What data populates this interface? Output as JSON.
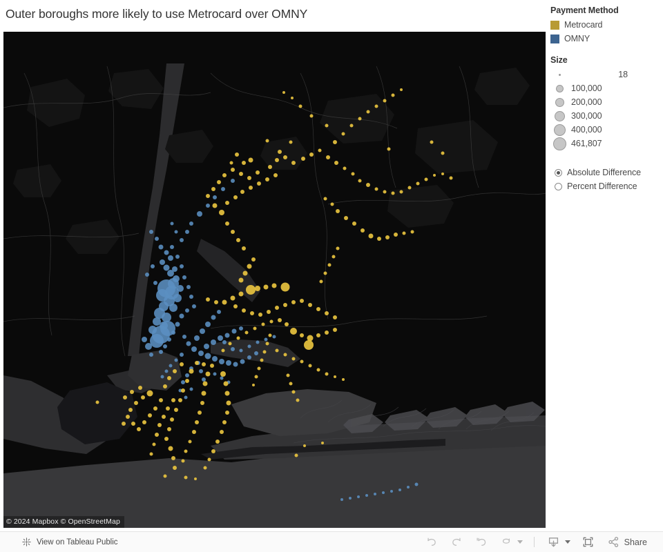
{
  "title": "Outer boroughs more likely to use Metrocard over OMNY",
  "map": {
    "attribution": "© 2024 Mapbox  © OpenStreetMap",
    "basemap_land": "#0a0a0a",
    "basemap_water": "#38383a",
    "basemap_parks": "#141414"
  },
  "legend": {
    "payment_method": {
      "title": "Payment Method",
      "items": [
        {
          "label": "Metrocard",
          "color": "#b89b35"
        },
        {
          "label": "OMNY",
          "color": "#3d6490"
        }
      ]
    },
    "size": {
      "title": "Size",
      "items": [
        {
          "value": "18",
          "diameter": 3
        },
        {
          "value": "100,000",
          "diameter": 11
        },
        {
          "value": "200,000",
          "diameter": 13
        },
        {
          "value": "300,000",
          "diameter": 15
        },
        {
          "value": "400,000",
          "diameter": 17
        },
        {
          "value": "461,807",
          "diameter": 19
        }
      ]
    }
  },
  "controls": {
    "options": [
      {
        "label": "Absolute Difference",
        "selected": true
      },
      {
        "label": "Percent Difference",
        "selected": false
      }
    ]
  },
  "toolbar": {
    "view_label": "View on Tableau Public",
    "tableau_logo_icon": "tableau-logo-icon",
    "buttons": [
      {
        "name": "undo-button",
        "icon": "undo-icon"
      },
      {
        "name": "redo-button",
        "icon": "redo-icon"
      },
      {
        "name": "revert-button",
        "icon": "revert-icon"
      },
      {
        "name": "refresh-button",
        "icon": "refresh-icon",
        "caret": true
      },
      {
        "name": "download-button",
        "icon": "download-icon",
        "caret": true
      },
      {
        "name": "fullscreen-button",
        "icon": "fullscreen-icon"
      }
    ],
    "share_label": "Share",
    "share_icon": "share-icon"
  },
  "chart_data": {
    "type": "scatter",
    "title": "Outer boroughs more likely to use Metrocard over OMNY",
    "description": "Geographic bubble map of NYC subway stations sized by absolute difference between Metrocard and OMNY taps, colored by dominant payment method.",
    "legend_position": "right",
    "series": [
      {
        "name": "Metrocard",
        "color": "#e8c33f",
        "point_count": 285
      },
      {
        "name": "OMNY",
        "color": "#5b90c2",
        "point_count": 118
      }
    ],
    "size_encoding": {
      "field": "Absolute Difference",
      "min": 18,
      "max": 461807
    },
    "selected_measure": "Absolute Difference"
  }
}
